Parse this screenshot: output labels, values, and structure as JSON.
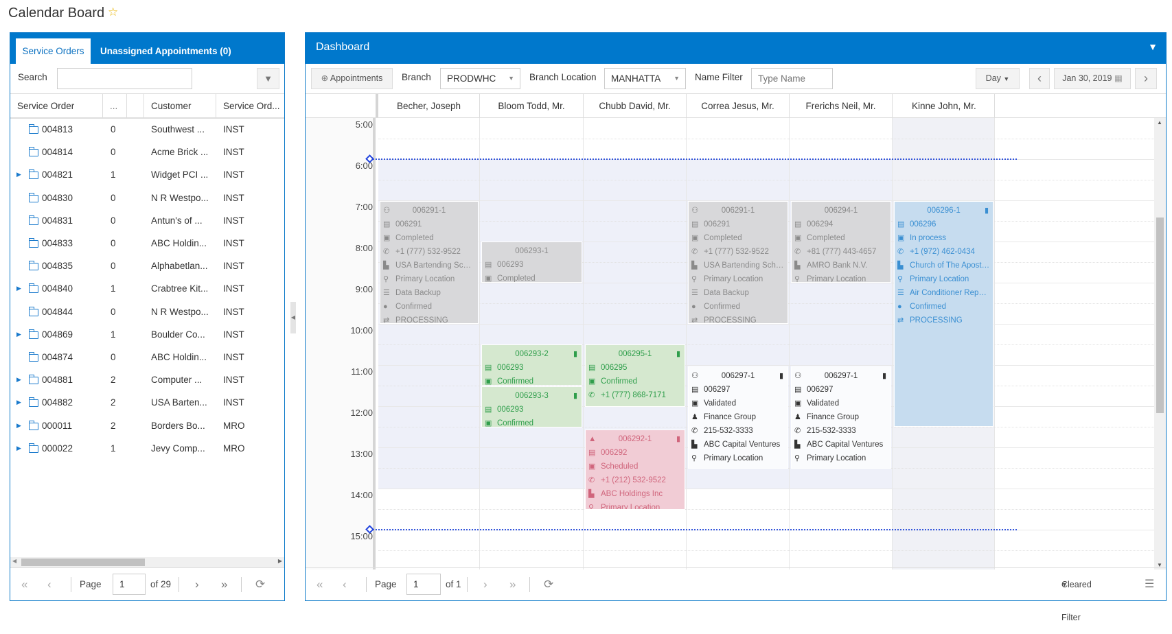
{
  "page": {
    "title": "Calendar Board"
  },
  "left": {
    "tabs": [
      "Service Orders",
      "Unassigned Appointments (0)"
    ],
    "search_label": "Search",
    "search_value": "",
    "columns": [
      "Service Order",
      "...",
      "",
      "Customer",
      "Service Ord..."
    ],
    "rows": [
      {
        "order": "004813",
        "count": "0",
        "customer": "Southwest ...",
        "type": "INST",
        "expandable": false
      },
      {
        "order": "004814",
        "count": "0",
        "customer": "Acme Brick ...",
        "type": "INST",
        "expandable": false
      },
      {
        "order": "004821",
        "count": "1",
        "customer": "Widget PCI ...",
        "type": "INST",
        "expandable": true
      },
      {
        "order": "004830",
        "count": "0",
        "customer": "N R Westpo...",
        "type": "INST",
        "expandable": false
      },
      {
        "order": "004831",
        "count": "0",
        "customer": "Antun's of ...",
        "type": "INST",
        "expandable": false
      },
      {
        "order": "004833",
        "count": "0",
        "customer": "ABC Holdin...",
        "type": "INST",
        "expandable": false
      },
      {
        "order": "004835",
        "count": "0",
        "customer": "Alphabetlan...",
        "type": "INST",
        "expandable": false
      },
      {
        "order": "004840",
        "count": "1",
        "customer": "Crabtree Kit...",
        "type": "INST",
        "expandable": true
      },
      {
        "order": "004844",
        "count": "0",
        "customer": "N R Westpo...",
        "type": "INST",
        "expandable": false
      },
      {
        "order": "004869",
        "count": "1",
        "customer": "Boulder Co...",
        "type": "INST",
        "expandable": true
      },
      {
        "order": "004874",
        "count": "0",
        "customer": "ABC Holdin...",
        "type": "INST",
        "expandable": false
      },
      {
        "order": "004881",
        "count": "2",
        "customer": "Computer ...",
        "type": "INST",
        "expandable": true
      },
      {
        "order": "004882",
        "count": "2",
        "customer": "USA Barten...",
        "type": "INST",
        "expandable": true
      },
      {
        "order": "000011",
        "count": "2",
        "customer": "Borders Bo...",
        "type": "MRO",
        "expandable": true
      },
      {
        "order": "000022",
        "count": "1",
        "customer": "Jevy Comp...",
        "type": "MRO",
        "expandable": true
      }
    ],
    "pager": {
      "page_label": "Page",
      "page": "1",
      "of": "of 29"
    }
  },
  "dashboard": {
    "title": "Dashboard",
    "toolbar": {
      "appointments": "Appointments",
      "branch_label": "Branch",
      "branch_value": "PRODWHC",
      "branch_location_label": "Branch Location",
      "branch_location_value": "MANHATTA",
      "name_filter_label": "Name Filter",
      "name_filter_placeholder": "Type Name",
      "view": "Day",
      "date": "Jan 30, 2019"
    },
    "resources": [
      "Becher, Joseph",
      "Bloom Todd, Mr.",
      "Chubb David, Mr.",
      "Correa Jesus, Mr.",
      "Frerichs Neil, Mr.",
      "Kinne John, Mr."
    ],
    "hours": [
      "5:00",
      "6:00",
      "7:00",
      "8:00",
      "9:00",
      "10:00",
      "11:00",
      "12:00",
      "13:00",
      "14:00",
      "15:00"
    ],
    "appointments": [
      {
        "resource": 0,
        "style": "gray",
        "title": "006291-1",
        "title_icon": "users-icon",
        "delete": false,
        "lines": [
          [
            "document-icon",
            "006291"
          ],
          [
            "calendar-check-icon",
            "Completed"
          ],
          [
            "phone-icon",
            "+1 (777) 532-9522"
          ],
          [
            "factory-icon",
            "USA Bartending School"
          ],
          [
            "map-pin-icon",
            "Primary Location"
          ],
          [
            "list-icon",
            "Data Backup"
          ],
          [
            "check-circle-icon",
            "Confirmed"
          ],
          [
            "retweet-icon",
            "PROCESSING"
          ]
        ]
      },
      {
        "resource": 1,
        "style": "gray",
        "title": "006293-1",
        "title_icon": "",
        "delete": false,
        "lines": [
          [
            "document-icon",
            "006293"
          ],
          [
            "calendar-check-icon",
            "Completed"
          ]
        ]
      },
      {
        "resource": 1,
        "style": "green",
        "title": "006293-2",
        "title_icon": "",
        "delete": true,
        "lines": [
          [
            "document-icon",
            "006293"
          ],
          [
            "calendar-check-icon",
            "Confirmed"
          ]
        ]
      },
      {
        "resource": 1,
        "style": "green",
        "title": "006293-3",
        "title_icon": "",
        "delete": true,
        "lines": [
          [
            "document-icon",
            "006293"
          ],
          [
            "calendar-check-icon",
            "Confirmed"
          ]
        ]
      },
      {
        "resource": 2,
        "style": "green",
        "title": "006295-1",
        "title_icon": "",
        "delete": true,
        "lines": [
          [
            "document-icon",
            "006295"
          ],
          [
            "calendar-check-icon",
            "Confirmed"
          ],
          [
            "phone-icon",
            "+1 (777) 868-7171"
          ]
        ]
      },
      {
        "resource": 2,
        "style": "red",
        "title": "006292-1",
        "title_icon": "warning-icon",
        "delete": true,
        "lines": [
          [
            "document-icon",
            "006292"
          ],
          [
            "calendar-check-icon",
            "Scheduled"
          ],
          [
            "phone-icon",
            "+1 (212) 532-9522"
          ],
          [
            "factory-icon",
            "ABC Holdings Inc"
          ],
          [
            "map-pin-icon",
            "Primary Location"
          ]
        ]
      },
      {
        "resource": 3,
        "style": "gray",
        "title": "006291-1",
        "title_icon": "users-icon",
        "delete": false,
        "lines": [
          [
            "document-icon",
            "006291"
          ],
          [
            "calendar-check-icon",
            "Completed"
          ],
          [
            "phone-icon",
            "+1 (777) 532-9522"
          ],
          [
            "factory-icon",
            "USA Bartending School"
          ],
          [
            "map-pin-icon",
            "Primary Location"
          ],
          [
            "list-icon",
            "Data Backup"
          ],
          [
            "check-circle-icon",
            "Confirmed"
          ],
          [
            "retweet-icon",
            "PROCESSING"
          ]
        ]
      },
      {
        "resource": 3,
        "style": "white",
        "title": "006297-1",
        "title_icon": "users-icon",
        "delete": true,
        "lines": [
          [
            "document-icon",
            "006297"
          ],
          [
            "calendar-check-icon",
            "Validated"
          ],
          [
            "user-icon",
            "Finance Group"
          ],
          [
            "phone-icon",
            "215-532-3333"
          ],
          [
            "factory-icon",
            "ABC Capital Ventures"
          ],
          [
            "map-pin-icon",
            "Primary Location"
          ]
        ]
      },
      {
        "resource": 4,
        "style": "gray",
        "title": "006294-1",
        "title_icon": "",
        "delete": false,
        "lines": [
          [
            "document-icon",
            "006294"
          ],
          [
            "calendar-check-icon",
            "Completed"
          ],
          [
            "phone-icon",
            "+81 (777) 443-4657"
          ],
          [
            "factory-icon",
            "AMRO Bank N.V."
          ],
          [
            "map-pin-icon",
            "Primary Location"
          ]
        ]
      },
      {
        "resource": 4,
        "style": "white",
        "title": "006297-1",
        "title_icon": "users-icon",
        "delete": true,
        "lines": [
          [
            "document-icon",
            "006297"
          ],
          [
            "calendar-check-icon",
            "Validated"
          ],
          [
            "user-icon",
            "Finance Group"
          ],
          [
            "phone-icon",
            "215-532-3333"
          ],
          [
            "factory-icon",
            "ABC Capital Ventures"
          ],
          [
            "map-pin-icon",
            "Primary Location"
          ]
        ]
      },
      {
        "resource": 5,
        "style": "blue",
        "title": "006296-1",
        "title_icon": "",
        "delete": true,
        "lines": [
          [
            "document-icon",
            "006296"
          ],
          [
            "calendar-check-icon",
            "In process"
          ],
          [
            "phone-icon",
            "+1 (972) 462-0434"
          ],
          [
            "factory-icon",
            "Church of The Apostles"
          ],
          [
            "map-pin-icon",
            "Primary Location"
          ],
          [
            "list-icon",
            "Air Conditioner Repair..."
          ],
          [
            "check-circle-icon",
            "Confirmed"
          ],
          [
            "retweet-icon",
            "PROCESSING"
          ]
        ]
      }
    ],
    "pager": {
      "page_label": "Page",
      "page": "1",
      "of": "of 1"
    },
    "filter_state": "Cleared Filter"
  }
}
